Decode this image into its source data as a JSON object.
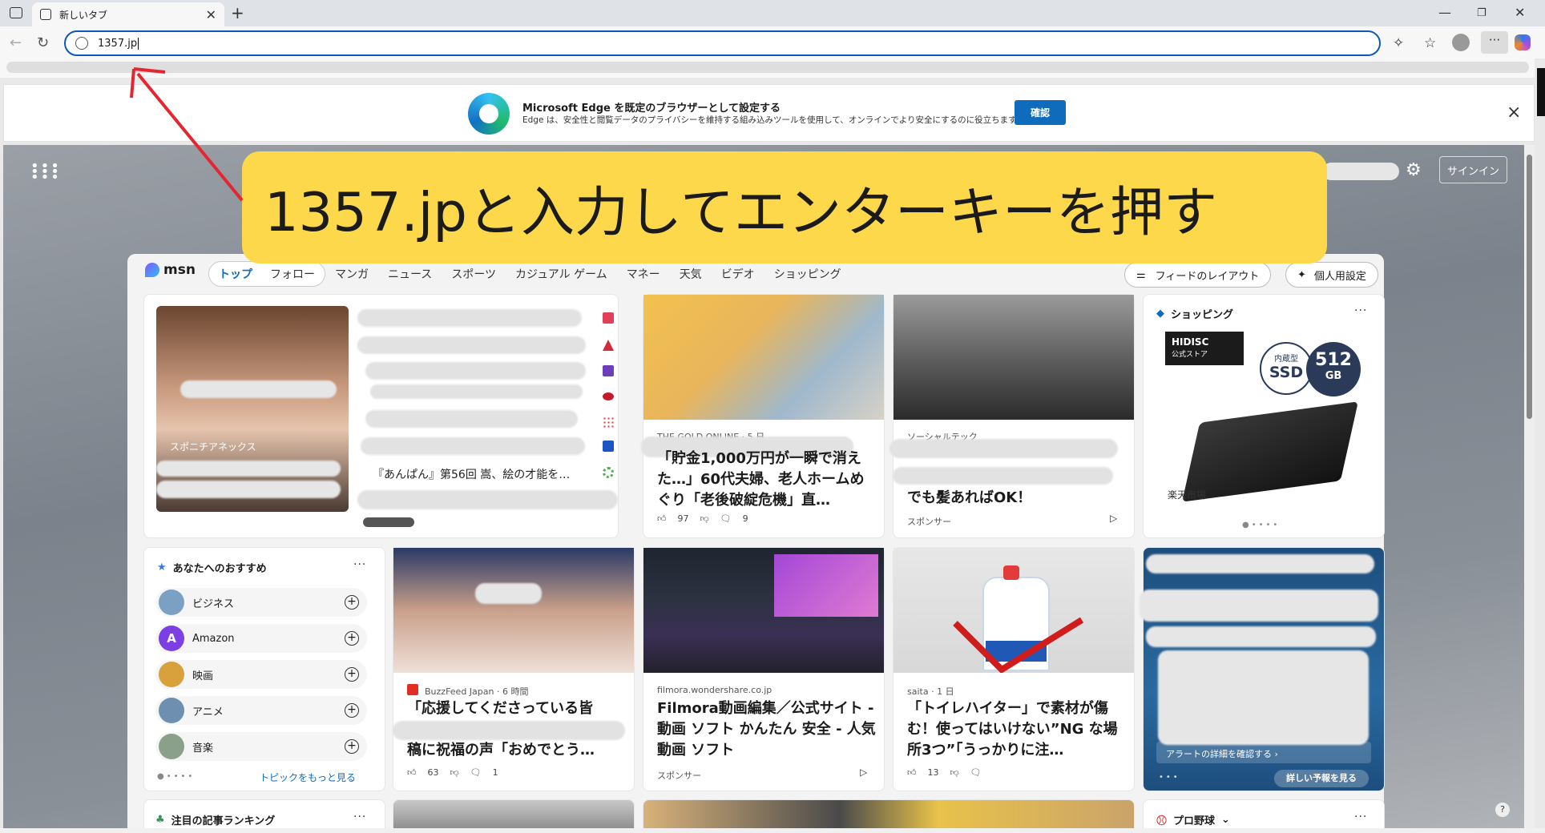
{
  "browser": {
    "tab_title": "新しいタブ",
    "address": "1357.jp",
    "colors": {
      "accent": "#0c59b8",
      "banner_button": "#0f6cbd"
    }
  },
  "banner": {
    "title": "Microsoft Edge を既定のブラウザーとして設定する",
    "subtitle": "Edge は、安全性と閲覧データのプライバシーを維持する組み込みツールを使用して、オンラインでより安全にするのに役立ちます",
    "button": "確認",
    "close": "×"
  },
  "ntp": {
    "signin": "サインイン",
    "callout": "1357.jpと入力してエンターキーを押す"
  },
  "msn": {
    "logo": "msn",
    "tabs_pill": [
      "トップ",
      "フォロー"
    ],
    "tabs": [
      "マンガ",
      "ニュース",
      "スポーツ",
      "カジュアル ゲーム",
      "マネー",
      "天気",
      "ビデオ",
      "ショッピング"
    ],
    "feed_layout": "フィードのレイアウト",
    "personalize": "個人用設定"
  },
  "hero": {
    "source": "スポニチアネックス",
    "list_item": "『あんぱん』第56回 嵩、絵の才能を…"
  },
  "cards": {
    "money": {
      "source": "THE GOLD ONLINE · 5 日",
      "headline": "「貯金1,000万円が一瞬で消えた…」60代夫婦、老人ホームめぐり「老後破綻危機」直…",
      "likes": "97",
      "comments": "9"
    },
    "social": {
      "source": "ソーシャルテック",
      "headline": "でも髪あればOK！",
      "sponsor": "スポンサー"
    },
    "shopping": {
      "title": "ショッピング",
      "brand": "HIDISC",
      "store": "公式ストア",
      "badge_top": "内蔵型",
      "badge_ssd": "SSD",
      "badge_size": "512",
      "badge_unit": "GB",
      "shop": "楽天市場"
    },
    "buzz": {
      "source": "BuzzFeed Japan · 6 時間",
      "headline_top": "「応援してくださっている皆",
      "headline_bottom": "稿に祝福の声「おめでとう…",
      "likes": "63",
      "comments": "1"
    },
    "filmora": {
      "source": "filmora.wondershare.co.jp",
      "headline": "Filmora動画編集／公式サイト - 動画 ソフト かんたん 安全 - 人気動画 ソフト",
      "sponsor": "スポンサー"
    },
    "saita": {
      "source": "saita · 1 日",
      "headline": "「トイレハイター」で素材が傷む！使ってはいけない”NG な場所3つ”「うっかりに注…",
      "likes": "13"
    },
    "weather": {
      "alert": "アラートの詳細を確認する ›",
      "forecast": "詳しい予報を見る"
    }
  },
  "recommend": {
    "title": "あなたへのおすすめ",
    "topics": [
      {
        "label": "ビジネス",
        "color": "#7aa0c4"
      },
      {
        "label": "Amazon",
        "color": "#7b3fe4",
        "initial": "A"
      },
      {
        "label": "映画",
        "color": "#d9a13b"
      },
      {
        "label": "アニメ",
        "color": "#6e8fb0"
      },
      {
        "label": "音楽",
        "color": "#8aa08a"
      }
    ],
    "more": "トピックをもっと見る"
  },
  "bottom": {
    "ranking": "注目の記事ランキング",
    "baseball": "プロ野球"
  }
}
